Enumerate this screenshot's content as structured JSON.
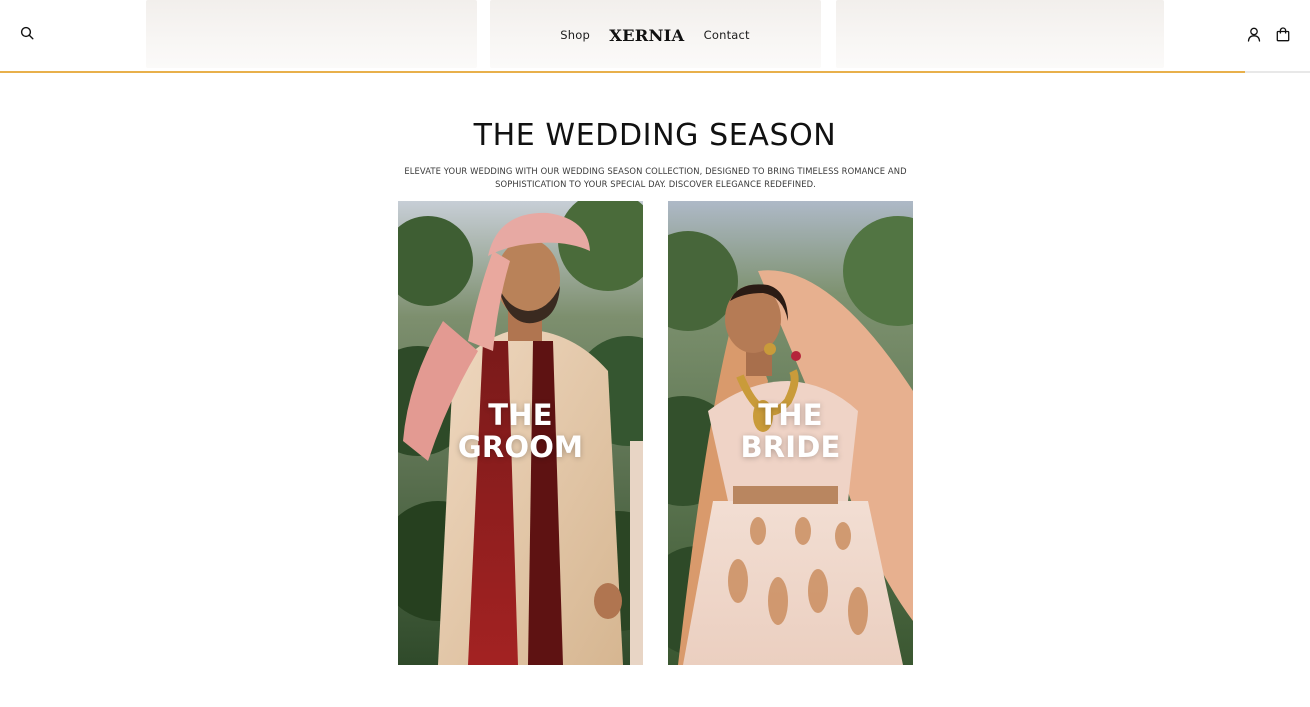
{
  "header": {
    "nav": {
      "shop_label": "Shop",
      "brand": "XERNIA",
      "contact_label": "Contact"
    },
    "scroll_progress_percent": 95,
    "accent_color": "#e8b04b"
  },
  "hero": {
    "title": "THE WEDDING SEASON",
    "subtitle": "ELEVATE YOUR WEDDING WITH OUR WEDDING SEASON COLLECTION, DESIGNED TO BRING TIMELESS ROMANCE AND SOPHISTICATION TO YOUR SPECIAL DAY. DISCOVER ELEGANCE REDEFINED."
  },
  "cards": [
    {
      "line1": "THE",
      "line2": "GROOM"
    },
    {
      "line1": "THE",
      "line2": "BRIDE"
    }
  ],
  "icons": {
    "search": "search-icon",
    "account": "user-icon",
    "cart": "shopping-bag-icon"
  }
}
